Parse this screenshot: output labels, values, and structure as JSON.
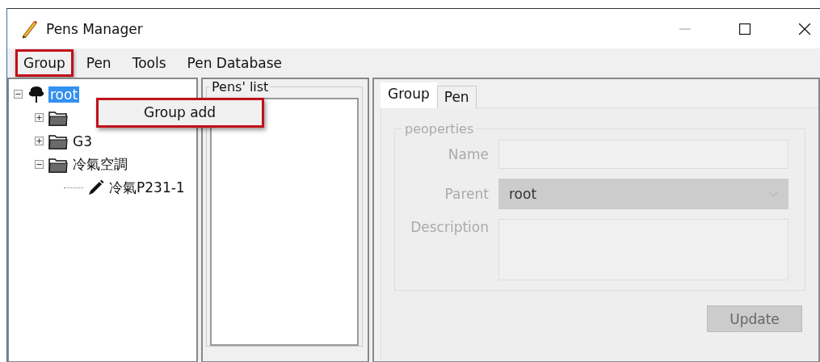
{
  "window": {
    "title": "Pens Manager"
  },
  "menu_bar": [
    {
      "label": "Group",
      "annotated": true
    },
    {
      "label": "Pen",
      "annotated": false
    },
    {
      "label": "Tools",
      "annotated": false
    },
    {
      "label": "Pen Database",
      "annotated": false
    }
  ],
  "tree": [
    {
      "kind": "root",
      "label": "root",
      "selected": true,
      "expanded": true,
      "children": [
        {
          "kind": "group",
          "expanded": false
        },
        {
          "kind": "group",
          "label": "G3",
          "selected": false,
          "expanded": false
        },
        {
          "kind": "group",
          "label": "冷氣空調",
          "selected": false,
          "expanded": true,
          "children": [
            {
              "kind": "pen",
              "label": "冷氣P231-1",
              "selected": false
            }
          ]
        }
      ]
    }
  ],
  "context_menu": [
    {
      "label": "Group add",
      "annotated": true
    }
  ],
  "pens_list": {
    "title": "Pens' list"
  },
  "tabs": [
    {
      "label": "Group",
      "selected": true
    },
    {
      "label": "Pen",
      "selected": false
    }
  ],
  "properties": {
    "title": "peoperties",
    "disabled": true,
    "name_label": "Name",
    "parent_label": "Parent",
    "parent_value": "root",
    "description_label": "Description"
  },
  "update_button": {
    "label": "Update",
    "disabled": true
  }
}
